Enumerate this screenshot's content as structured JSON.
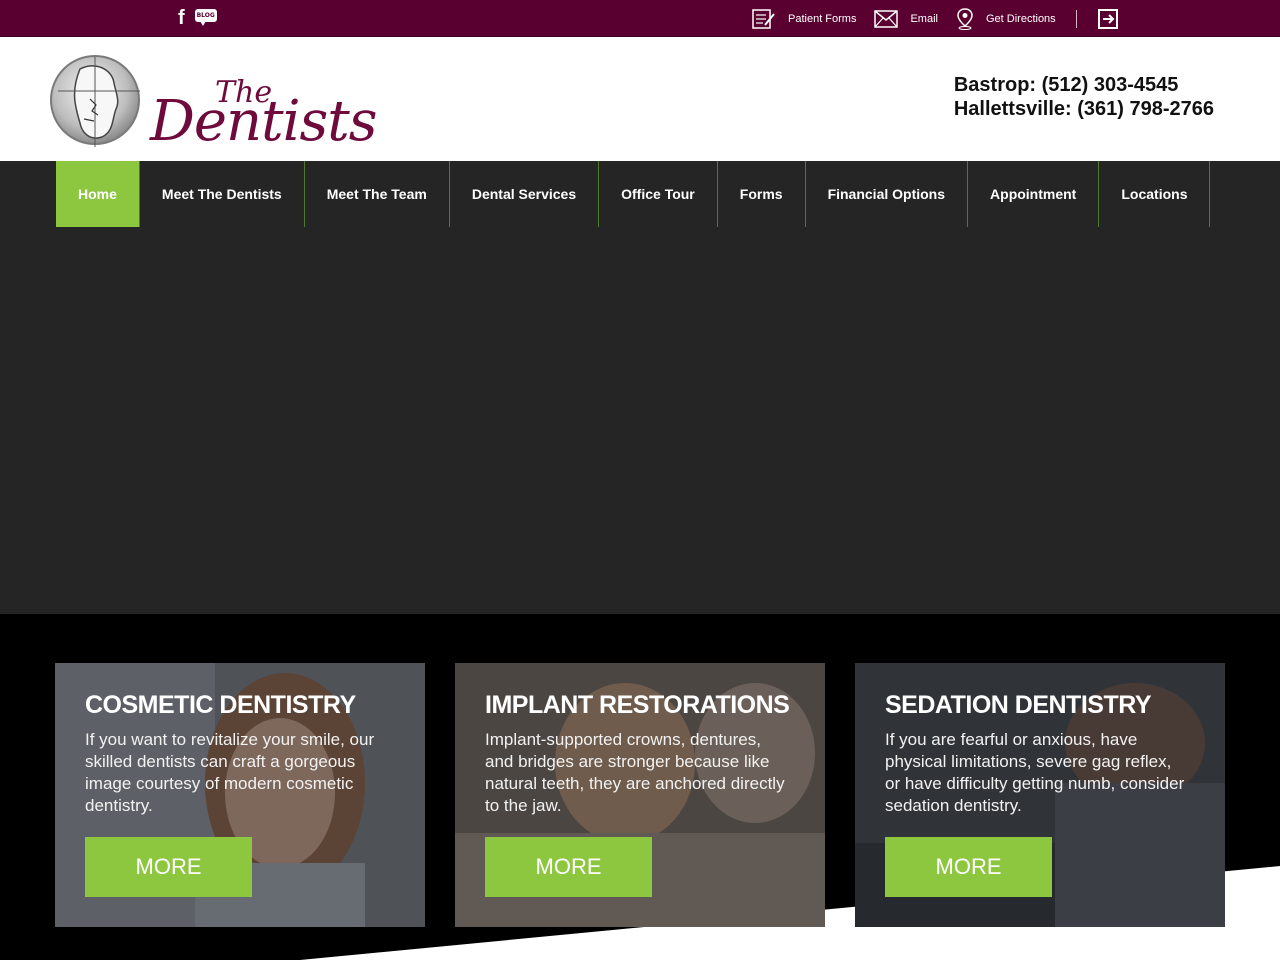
{
  "topbar": {
    "facebook_glyph": "f",
    "blog_label": "BLOG",
    "links": [
      {
        "label": "Patient Forms",
        "icon": "forms-icon"
      },
      {
        "label": "Email",
        "icon": "envelope-icon"
      },
      {
        "label": "Get Directions",
        "icon": "map-pin-icon"
      }
    ],
    "login_icon": "login-icon"
  },
  "header": {
    "logo_the": "The",
    "logo_dentists": "Dentists",
    "phones": [
      "Bastrop: (512) 303-4545",
      "Hallettsville: (361) 798-2766"
    ]
  },
  "nav": {
    "items": [
      {
        "label": "Home",
        "active": true
      },
      {
        "label": "Meet The Dentists"
      },
      {
        "label": "Meet The Team"
      },
      {
        "label": "Dental Services"
      },
      {
        "label": "Office Tour"
      },
      {
        "label": "Forms"
      },
      {
        "label": "Financial Options"
      },
      {
        "label": "Appointment"
      },
      {
        "label": "Locations"
      }
    ]
  },
  "services": [
    {
      "title": "COSMETIC DENTISTRY",
      "text": "If you want to revitalize your smile, our skilled dentists can craft a gorgeous image courtesy of modern cosmetic dentistry.",
      "button": "MORE"
    },
    {
      "title": "IMPLANT RESTORATIONS",
      "text": "Implant-supported crowns, dentures, and bridges are stronger because like natural teeth, they are anchored directly to the jaw.",
      "button": "MORE"
    },
    {
      "title": "SEDATION DENTISTRY",
      "text": "If you are fearful or anxious, have physical limitations, severe gag reflex, or have difficulty getting numb, consider sedation dentistry.",
      "button": "MORE"
    }
  ],
  "colors": {
    "topbar": "#5a0030",
    "brand": "#6e0a3c",
    "accent": "#8dc63f",
    "nav": "#252525"
  }
}
